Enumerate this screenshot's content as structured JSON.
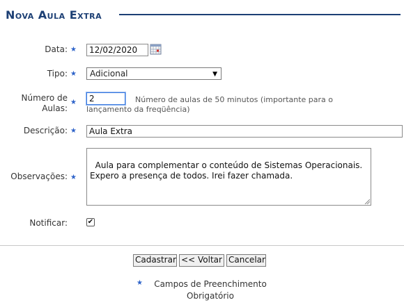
{
  "header": {
    "title": "Nova Aula Extra"
  },
  "form": {
    "date": {
      "label": "Data:",
      "value": "12/02/2020",
      "icon": "calendar-icon"
    },
    "type": {
      "label": "Tipo:",
      "value": "Adicional"
    },
    "lessons": {
      "label_line1": "Número de",
      "label_line2": "Aulas:",
      "value": "2",
      "hint_line1": "Número de aulas de 50 minutos (importante para o",
      "hint_line2": "lançamento da freqüência)"
    },
    "description": {
      "label": "Descrição:",
      "value": "Aula Extra"
    },
    "notes": {
      "label": "Observações:",
      "value": "Aula para complementar o conteúdo de Sistemas Operacionais.\nExpero a presença de todos. Irei fazer chamada."
    },
    "notify": {
      "label": "Notificar:",
      "checked": true,
      "mark": "✔"
    }
  },
  "buttons": {
    "register": "Cadastrar",
    "back": "<< Voltar",
    "cancel": "Cancelar"
  },
  "required_note": {
    "line1": "Campos de Preenchimento",
    "line2": "Obrigatório"
  },
  "required_mark": "★",
  "colors": {
    "title": "#1c3f74",
    "required_star": "#2e63c9"
  }
}
